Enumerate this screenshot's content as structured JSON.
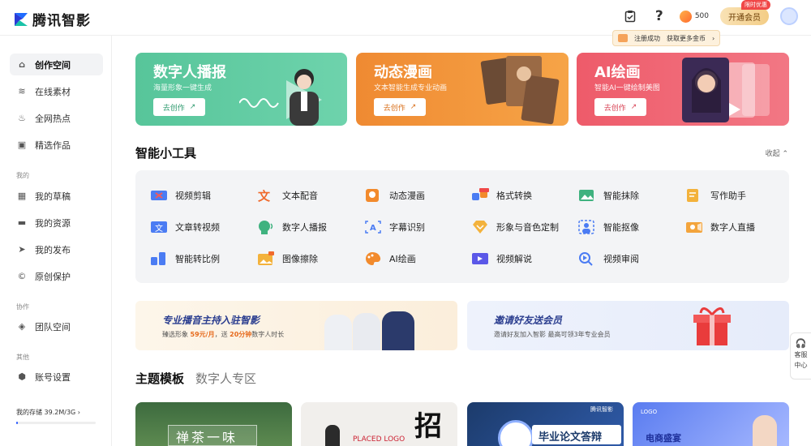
{
  "header": {
    "logo_text": "腾讯智影",
    "coins": "500",
    "vip_label": "开通会员",
    "vip_tag": "限时优惠",
    "tip_left": "注册成功",
    "tip_right": "获取更多金币"
  },
  "sidebar": {
    "items": [
      {
        "label": "创作空间",
        "icon": "home-icon"
      },
      {
        "label": "在线素材",
        "icon": "layers-icon"
      },
      {
        "label": "全网热点",
        "icon": "fire-icon"
      },
      {
        "label": "精选作品",
        "icon": "video-icon"
      }
    ],
    "group_mine": "我的",
    "mine_items": [
      {
        "label": "我的草稿",
        "icon": "grid-icon"
      },
      {
        "label": "我的资源",
        "icon": "folder-icon"
      },
      {
        "label": "我的发布",
        "icon": "send-icon"
      },
      {
        "label": "原创保护",
        "icon": "copyright-icon"
      }
    ],
    "group_collab": "协作",
    "collab_items": [
      {
        "label": "团队空间",
        "icon": "cube-icon"
      }
    ],
    "group_other": "其他",
    "other_items": [
      {
        "label": "账号设置",
        "icon": "settings-icon"
      }
    ],
    "storage_label": "我的存储",
    "storage_value": "39.2M/3G",
    "storage_fraction": 0.013
  },
  "banners": [
    {
      "title": "数字人播报",
      "sub": "海量形象一键生成",
      "btn": "去创作"
    },
    {
      "title": "动态漫画",
      "sub": "文本智能生成专业动画",
      "btn": "去创作"
    },
    {
      "title": "AI绘画",
      "sub": "智能AI一键绘制美图",
      "btn": "去创作"
    }
  ],
  "tools_section": {
    "title": "智能小工具",
    "collapse": "收起"
  },
  "tools": [
    "视频剪辑",
    "文本配音",
    "动态漫画",
    "格式转换",
    "智能抹除",
    "写作助手",
    "文章转视频",
    "数字人播报",
    "字幕识别",
    "形象与音色定制",
    "智能抠像",
    "数字人直播",
    "智能转比例",
    "图像擦除",
    "AI绘画",
    "视频解说",
    "视频审阅"
  ],
  "promos": {
    "left_title": "专业播音主持入驻智影",
    "left_sub_a": "臻选形象",
    "left_sub_b": "59元/月",
    "left_sub_c": "，送",
    "left_sub_d": "20分钟",
    "left_sub_e": "数字人时长",
    "right_title": "邀请好友送会员",
    "right_sub": "邀请好友加入智影 最高可领3年专业会员"
  },
  "tabs": [
    "主题模板",
    "数字人专区"
  ],
  "templates": {
    "t1": "禅茶一味",
    "t2_logo": "PLACED LOGO",
    "t2_big": "招",
    "t3_brand": "腾讯智影",
    "t3_title": "毕业论文答辩",
    "t4_logo": "LOGO",
    "t4_title": "电商盛宴"
  },
  "service": {
    "line1": "客服",
    "line2": "中心"
  }
}
